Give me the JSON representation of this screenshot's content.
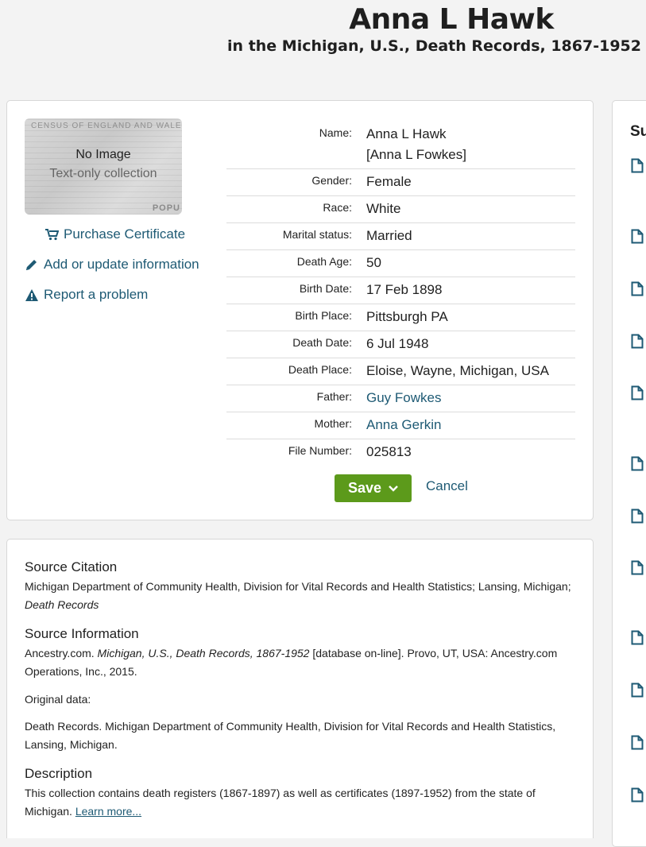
{
  "header": {
    "title": "Anna L Hawk",
    "subtitle": "in the Michigan, U.S., Death Records, 1867-1952"
  },
  "image": {
    "no_image": "No Image",
    "text_only": "Text-only collection",
    "watermark_top": "CENSUS OF ENGLAND AND WALES,",
    "watermark_bottom": "POPU"
  },
  "actions": {
    "purchase": "Purchase Certificate",
    "add_update": "Add or update information",
    "report": "Report a problem"
  },
  "fields": [
    {
      "label": "Name:",
      "value": "Anna L Hawk",
      "value2": "[Anna L Fowkes]"
    },
    {
      "label": "Gender:",
      "value": "Female"
    },
    {
      "label": "Race:",
      "value": "White"
    },
    {
      "label": "Marital status:",
      "value": "Married"
    },
    {
      "label": "Death Age:",
      "value": "50"
    },
    {
      "label": "Birth Date:",
      "value": "17 Feb 1898"
    },
    {
      "label": "Birth Place:",
      "value": "Pittsburgh PA"
    },
    {
      "label": "Death Date:",
      "value": "6 Jul 1948"
    },
    {
      "label": "Death Place:",
      "value": "Eloise, Wayne, Michigan, USA"
    },
    {
      "label": "Father:",
      "value": "Guy Fowkes"
    },
    {
      "label": "Mother:",
      "value": "Anna Gerkin"
    },
    {
      "label": "File Number:",
      "value": "025813"
    }
  ],
  "buttons": {
    "save": "Save",
    "cancel": "Cancel"
  },
  "source": {
    "citation_heading": "Source Citation",
    "citation_text": "Michigan Department of Community Health, Division for Vital Records and Health Statistics; Lansing, Michigan;",
    "citation_italic": "Death Records",
    "info_heading": "Source Information",
    "info_prefix": "Ancestry.com.",
    "info_italic": "Michigan, U.S., Death Records, 1867-1952",
    "info_suffix": "[database on-line]. Provo, UT, USA: Ancestry.com Operations, Inc., 2015.",
    "original_label": "Original data:",
    "original_text": "Death Records. Michigan Department of Community Health, Division for Vital Records and Health Statistics, Lansing, Michigan.",
    "description_heading": "Description",
    "description_text": "This collection contains death registers (1867-1897) as well as certificates (1897-1952) from the state of Michigan.",
    "learn_more": "Learn more..."
  },
  "sidebar": {
    "heading_partial": "Su"
  },
  "colors": {
    "link": "#1e5a74",
    "save_button": "#5c9a1b",
    "background": "#f3f3f3"
  },
  "icons": [
    "cart-icon",
    "pencil-icon",
    "warning-icon",
    "chevron-down-icon",
    "document-icon"
  ]
}
